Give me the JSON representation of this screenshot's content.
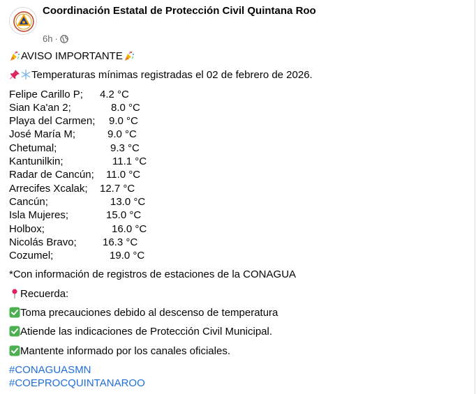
{
  "post": {
    "page_name": "Coordinación Estatal de Protección Civil Quintana Roo",
    "time": "6h",
    "dot": "·",
    "icons": {
      "avatar": "protección-civil-seal",
      "audience": "globe-icon",
      "party": "party-popper-icon",
      "pin": "pushpin-icon",
      "snow": "snowflake-icon",
      "location": "round-pushpin-icon",
      "check": "green-check-icon"
    },
    "headline": "AVISO IMPORTANTE",
    "intro": "Temperaturas mínimas registradas el 02 de febrero de 2026.",
    "temperatures": [
      {
        "station": "Felipe Carillo P;",
        "value": "4.2 °C"
      },
      {
        "station": "Sian Ka'an 2;",
        "value": "8.0 °C"
      },
      {
        "station": "Playa del Carmen;",
        "value": "9.0 °C"
      },
      {
        "station": "José María M;",
        "value": "9.0 °C"
      },
      {
        "station": "Chetumal;",
        "value": "9.3 °C"
      },
      {
        "station": "Kantunilkin;",
        "value": "11.1 °C"
      },
      {
        "station": "Radar de Cancún;",
        "value": "11.0 °C"
      },
      {
        "station": "Arrecifes Xcalak;",
        "value": "12.7 °C"
      },
      {
        "station": "Cancún;",
        "value": "13.0 °C"
      },
      {
        "station": "Isla Mujeres;",
        "value": "15.0 °C"
      },
      {
        "station": "Holbox;",
        "value": "16.0 °C"
      },
      {
        "station": "Nicolás Bravo;",
        "value": "16.3 °C"
      },
      {
        "station": "Cozumel;",
        "value": "19.0 °C"
      }
    ],
    "source_note": "*Con información de registros de estaciones de la CONAGUA",
    "reminder_label": "Recuerda:",
    "tips": [
      "Toma precauciones debido al descenso de temperatura",
      "Atiende las indicaciones de Protección Civil Municipal.",
      "Mantente informado por los canales oficiales."
    ],
    "hashtags": [
      "#CONAGUASMN",
      "#COEPROCQUINTANAROO"
    ],
    "colors": {
      "text": "#050505",
      "secondary": "#65676b",
      "hashtag": "#216fdb",
      "check": "#4caf50"
    }
  }
}
